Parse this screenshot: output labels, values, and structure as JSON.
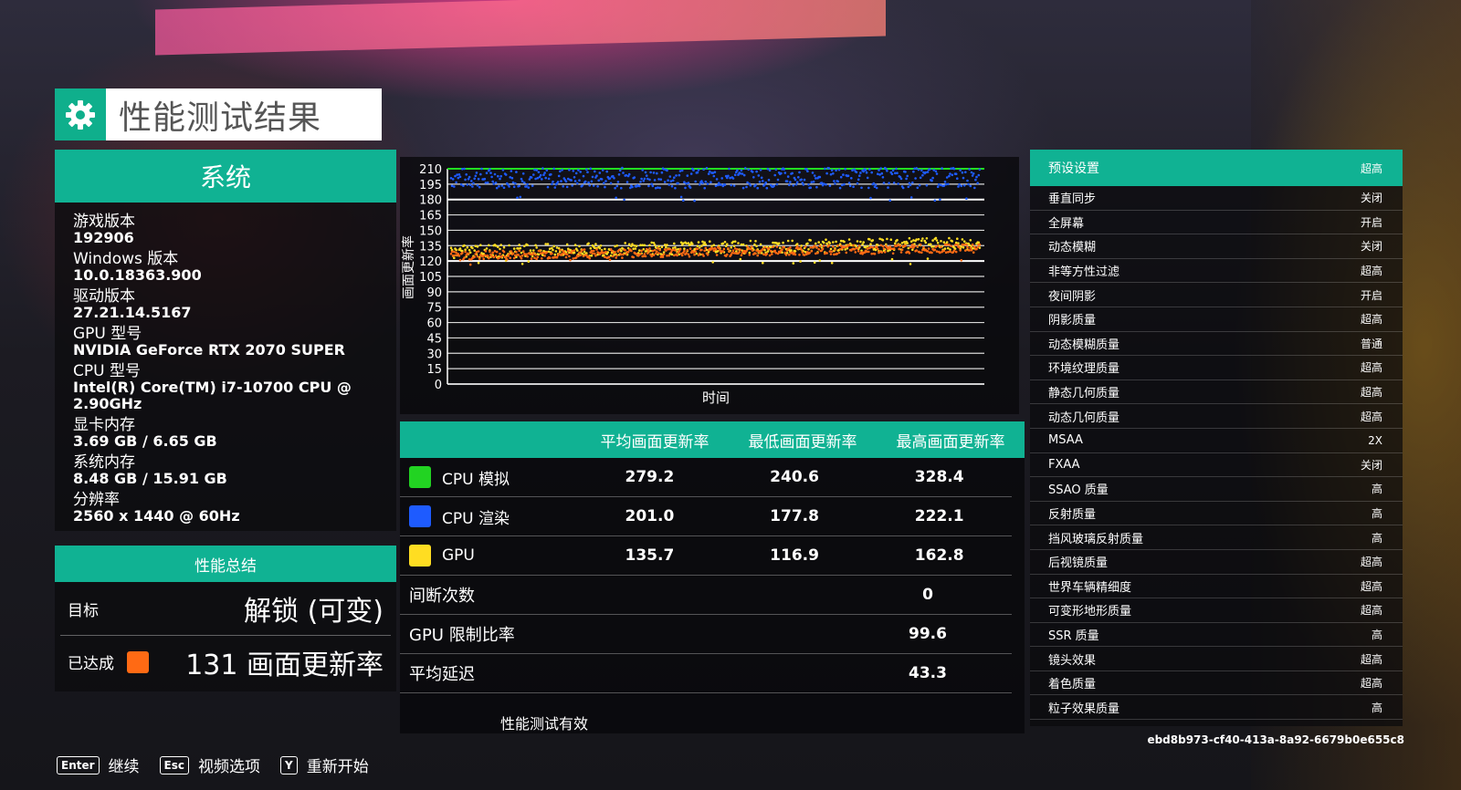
{
  "title": "性能测试结果",
  "system": {
    "header": "系统",
    "items": [
      {
        "label": "游戏版本",
        "value": "192906"
      },
      {
        "label": "Windows 版本",
        "value": "10.0.18363.900"
      },
      {
        "label": "驱动版本",
        "value": "27.21.14.5167"
      },
      {
        "label": "GPU 型号",
        "value": "NVIDIA GeForce RTX 2070 SUPER"
      },
      {
        "label": "CPU 型号",
        "value": "Intel(R) Core(TM) i7-10700 CPU @ 2.90GHz"
      },
      {
        "label": "显卡内存",
        "value": "3.69 GB / 6.65 GB"
      },
      {
        "label": "系统内存",
        "value": "8.48 GB / 15.91 GB"
      },
      {
        "label": "分辨率",
        "value": "2560 x 1440 @ 60Hz"
      }
    ]
  },
  "summary": {
    "header": "性能总结",
    "target_label": "目标",
    "target_value": "解锁 (可变)",
    "achieved_label": "已达成",
    "achieved_value": "131 画面更新率",
    "achieved_color": "#ff6a14"
  },
  "chart_data": {
    "type": "scatter",
    "ylabel": "画面更新率",
    "xlabel": "时间",
    "ylim": [
      0,
      210
    ],
    "yticks": [
      0,
      15,
      30,
      45,
      60,
      75,
      90,
      105,
      120,
      135,
      150,
      165,
      180,
      195,
      210
    ],
    "reference_lines": [
      {
        "value": 210,
        "color": "#22dd22"
      },
      {
        "value": 180,
        "color": "#ffffff"
      },
      {
        "value": 120,
        "color": "#ffffff"
      }
    ],
    "series": [
      {
        "name": "CPU 渲染",
        "color": "#1e5bff",
        "approx_level": 201,
        "approx_min": 178,
        "approx_max": 222
      },
      {
        "name": "GPU",
        "color": "#ffdd22",
        "approx_level": 129,
        "approx_min": 117,
        "approx_max": 145
      },
      {
        "color": "#ff6a14",
        "approx_level": 125,
        "approx_min": 116,
        "approx_max": 136
      }
    ]
  },
  "stats": {
    "headers": [
      "平均画面更新率",
      "最低画面更新率",
      "最高画面更新率"
    ],
    "rows": [
      {
        "name": "CPU 模拟",
        "color": "#22d322",
        "avg": "279.2",
        "min": "240.6",
        "max": "328.4"
      },
      {
        "name": "CPU 渲染",
        "color": "#1e5bff",
        "avg": "201.0",
        "min": "177.8",
        "max": "222.1"
      },
      {
        "name": "GPU",
        "color": "#ffdd22",
        "avg": "135.7",
        "min": "116.9",
        "max": "162.8"
      }
    ],
    "extra": [
      {
        "label": "间断次数",
        "value": "0"
      },
      {
        "label": "GPU 限制比率",
        "value": "99.6"
      },
      {
        "label": "平均延迟",
        "value": "43.3"
      }
    ],
    "valid_text": "性能测试有效"
  },
  "settings": {
    "preset_label": "预设设置",
    "preset_value": "超高",
    "items": [
      {
        "label": "垂直同步",
        "value": "关闭"
      },
      {
        "label": "全屏幕",
        "value": "开启"
      },
      {
        "label": "动态模糊",
        "value": "关闭"
      },
      {
        "label": "非等方性过滤",
        "value": "超高"
      },
      {
        "label": "夜间阴影",
        "value": "开启"
      },
      {
        "label": "阴影质量",
        "value": "超高"
      },
      {
        "label": "动态模糊质量",
        "value": "普通"
      },
      {
        "label": "环境纹理质量",
        "value": "超高"
      },
      {
        "label": "静态几何质量",
        "value": "超高"
      },
      {
        "label": "动态几何质量",
        "value": "超高"
      },
      {
        "label": "MSAA",
        "value": "2X"
      },
      {
        "label": "FXAA",
        "value": "关闭"
      },
      {
        "label": "SSAO 质量",
        "value": "高"
      },
      {
        "label": "反射质量",
        "value": "高"
      },
      {
        "label": "挡风玻璃反射质量",
        "value": "高"
      },
      {
        "label": "后视镜质量",
        "value": "超高"
      },
      {
        "label": "世界车辆精细度",
        "value": "超高"
      },
      {
        "label": "可变形地形质量",
        "value": "超高"
      },
      {
        "label": "SSR 质量",
        "value": "高"
      },
      {
        "label": "镜头效果",
        "value": "超高"
      },
      {
        "label": "着色质量",
        "value": "超高"
      },
      {
        "label": "粒子效果质量",
        "value": "高"
      }
    ]
  },
  "uuid": "ebd8b973-cf40-413a-8a92-6679b0e655c8",
  "footer": [
    {
      "key": "Enter",
      "label": "继续"
    },
    {
      "key": "Esc",
      "label": "视频选项"
    },
    {
      "key": "Y",
      "label": "重新开始"
    }
  ]
}
